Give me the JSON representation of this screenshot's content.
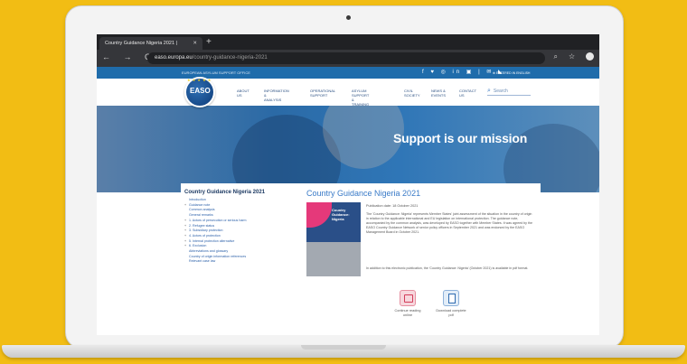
{
  "browser": {
    "tab_title": "Country Guidance Nigeria 2021 |",
    "tab_close": "✕",
    "new_tab": "+",
    "nav_icons": "← → C ⌂",
    "url_host": "easo.europa.eu",
    "url_path": "/country-guidance-nigeria-2021",
    "right_icons": "⌕ ☆"
  },
  "site": {
    "org_name": "EUROPEAN ASYLUM SUPPORT OFFICE",
    "social_icons": "f ♥ ◎ in ▣ | ✉ ◣",
    "lang": "⊕ ENTERED IN ENGLISH",
    "logo_text": "EASO",
    "logo_stars": "★ ★ ★ ★ ★",
    "menu": [
      {
        "label": "ABOUT\nUS"
      },
      {
        "label": "INFORMATION &\nANALYSIS"
      },
      {
        "label": "OPERATIONAL\nSUPPORT"
      },
      {
        "label": "ASYLUM SUPPORT &\nTRAINING"
      },
      {
        "label": "CIVIL\nSOCIETY"
      },
      {
        "label": "NEWS &\nEVENTS"
      },
      {
        "label": "CONTACT\nUS"
      }
    ],
    "search_icon": "⌕",
    "search_placeholder": "Search"
  },
  "hero": {
    "text": "Support is our mission"
  },
  "toc": {
    "title": "Country Guidance Nigeria 2021",
    "items": [
      {
        "pm": "",
        "label": "Introduction"
      },
      {
        "pm": "+",
        "label": "Guidance note"
      },
      {
        "pm": "",
        "label": "Common analysis"
      },
      {
        "pm": "",
        "label": "General remarks"
      },
      {
        "pm": "+",
        "label": "1. Actors of persecution or serious harm"
      },
      {
        "pm": "+",
        "label": "2. Refugee status"
      },
      {
        "pm": "+",
        "label": "3. Subsidiary protection"
      },
      {
        "pm": "+",
        "label": "4. Actors of protection"
      },
      {
        "pm": "+",
        "label": "5. Internal protection alternative"
      },
      {
        "pm": "+",
        "label": "6. Exclusion"
      },
      {
        "pm": "",
        "label": "Abbreviations and glossary"
      },
      {
        "pm": "",
        "label": "Country of origin information references"
      },
      {
        "pm": "",
        "label": "Relevant case law"
      }
    ]
  },
  "document": {
    "title": "Country Guidance Nigeria 2021",
    "cover_title": "Country\nGuidance:\nNigeria",
    "publication_date": "Publication date: 18 October 2021",
    "description": "The 'Country Guidance: Nigeria' represents Member States' joint assessment of the situation in the country of origin in relation to the applicable international and EU legislation on international protection. The guidance note, accompanied by the common analysis, was developed by EASO together with Member States. It was agreed by the EASO Country Guidance Network of senior policy officers in September 2021 and was endorsed by the EASO Management Board in October 2021.",
    "description2": "In addition to this electronic publication, the 'Country Guidance: Nigeria' (October 2021) is available in pdf format.",
    "actions": [
      {
        "label": "Continue reading\nonline"
      },
      {
        "label": "Download complete\npdf"
      }
    ]
  },
  "colors": {
    "background": "#f2bd14",
    "brand_blue": "#1f6cab",
    "link_blue": "#3a7bc8",
    "accent_pink": "#e5397a"
  }
}
